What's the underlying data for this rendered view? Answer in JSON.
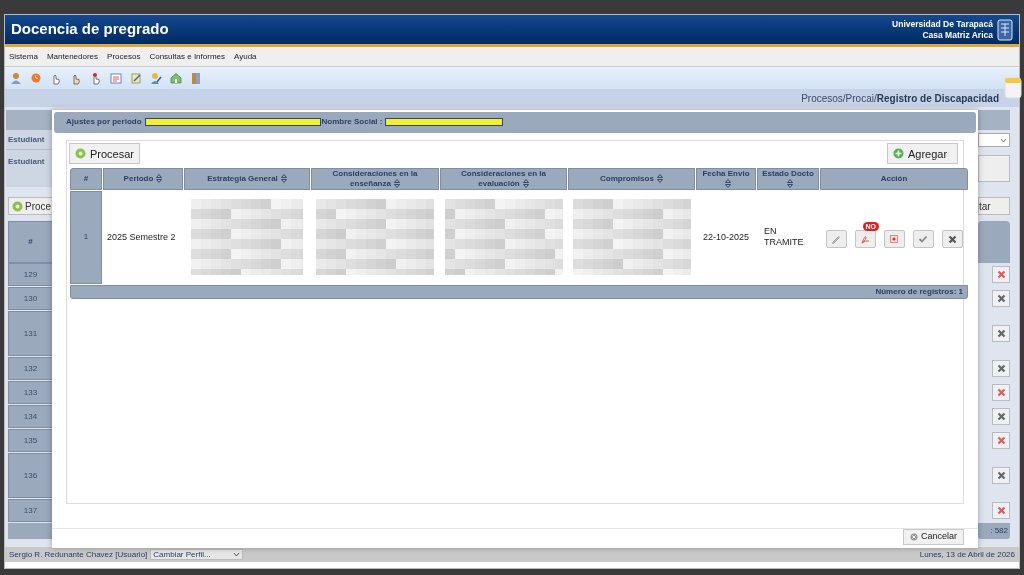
{
  "app": {
    "title": "Docencia de pregrado",
    "university": "Universidad De Tarapacá",
    "campus": "Casa Matriz Arica"
  },
  "menu": [
    {
      "label": "Sistema"
    },
    {
      "label": "Mantenedores"
    },
    {
      "label": "Procesos"
    },
    {
      "label": "Consultas e Informes"
    },
    {
      "label": "Ayuda"
    }
  ],
  "breadcrumb": {
    "path": "Procesos/Procai/",
    "current": "Registro de Discapacidad"
  },
  "background": {
    "labels": [
      "Estudiant",
      "Estudiant"
    ],
    "left_button": "Proce",
    "right_button": "tar",
    "number_header": "#",
    "footer_count": ": 582",
    "rows": [
      {
        "number": "129",
        "tall": false,
        "delete_enabled": true
      },
      {
        "number": "130",
        "tall": false,
        "delete_enabled": false
      },
      {
        "number": "131",
        "tall": true,
        "delete_enabled": false
      },
      {
        "number": "132",
        "tall": false,
        "delete_enabled": false
      },
      {
        "number": "133",
        "tall": false,
        "delete_enabled": true
      },
      {
        "number": "134",
        "tall": false,
        "delete_enabled": false
      },
      {
        "number": "135",
        "tall": false,
        "delete_enabled": true
      },
      {
        "number": "136",
        "tall": true,
        "delete_enabled": false
      },
      {
        "number": "137",
        "tall": false,
        "delete_enabled": true
      }
    ]
  },
  "modal": {
    "period_label": "Ajustes por periodo",
    "social_label": "Nombre Social :",
    "process_button": "Procesar",
    "add_button": "Agregar",
    "columns": [
      {
        "label": "#",
        "sortable": false
      },
      {
        "label": "Periodo",
        "sortable": true
      },
      {
        "label": "Estrategia General",
        "sortable": true
      },
      {
        "label": "Consideraciones en la enseñanza",
        "sortable": true
      },
      {
        "label": "Consideraciones en la evaluación",
        "sortable": true
      },
      {
        "label": "Compromisos",
        "sortable": true
      },
      {
        "label": "Fecha Envio",
        "sortable": true
      },
      {
        "label": "Estado Docto",
        "sortable": true
      },
      {
        "label": "Acción",
        "sortable": false
      }
    ],
    "rows": [
      {
        "number": "1",
        "period": "2025 Semestre 2",
        "date": "22-10-2025",
        "status": "EN TRAMITE",
        "pdf_badge": "NO"
      }
    ],
    "footer": "Número de registros: 1",
    "cancel_button": "Cancelar"
  },
  "status_bar": {
    "user": "Sergio R. Redunante Chavez [Usuario]",
    "profile_select": "Cambiar Perfil...",
    "date": "Lunes, 13 de Abril de 2026"
  }
}
